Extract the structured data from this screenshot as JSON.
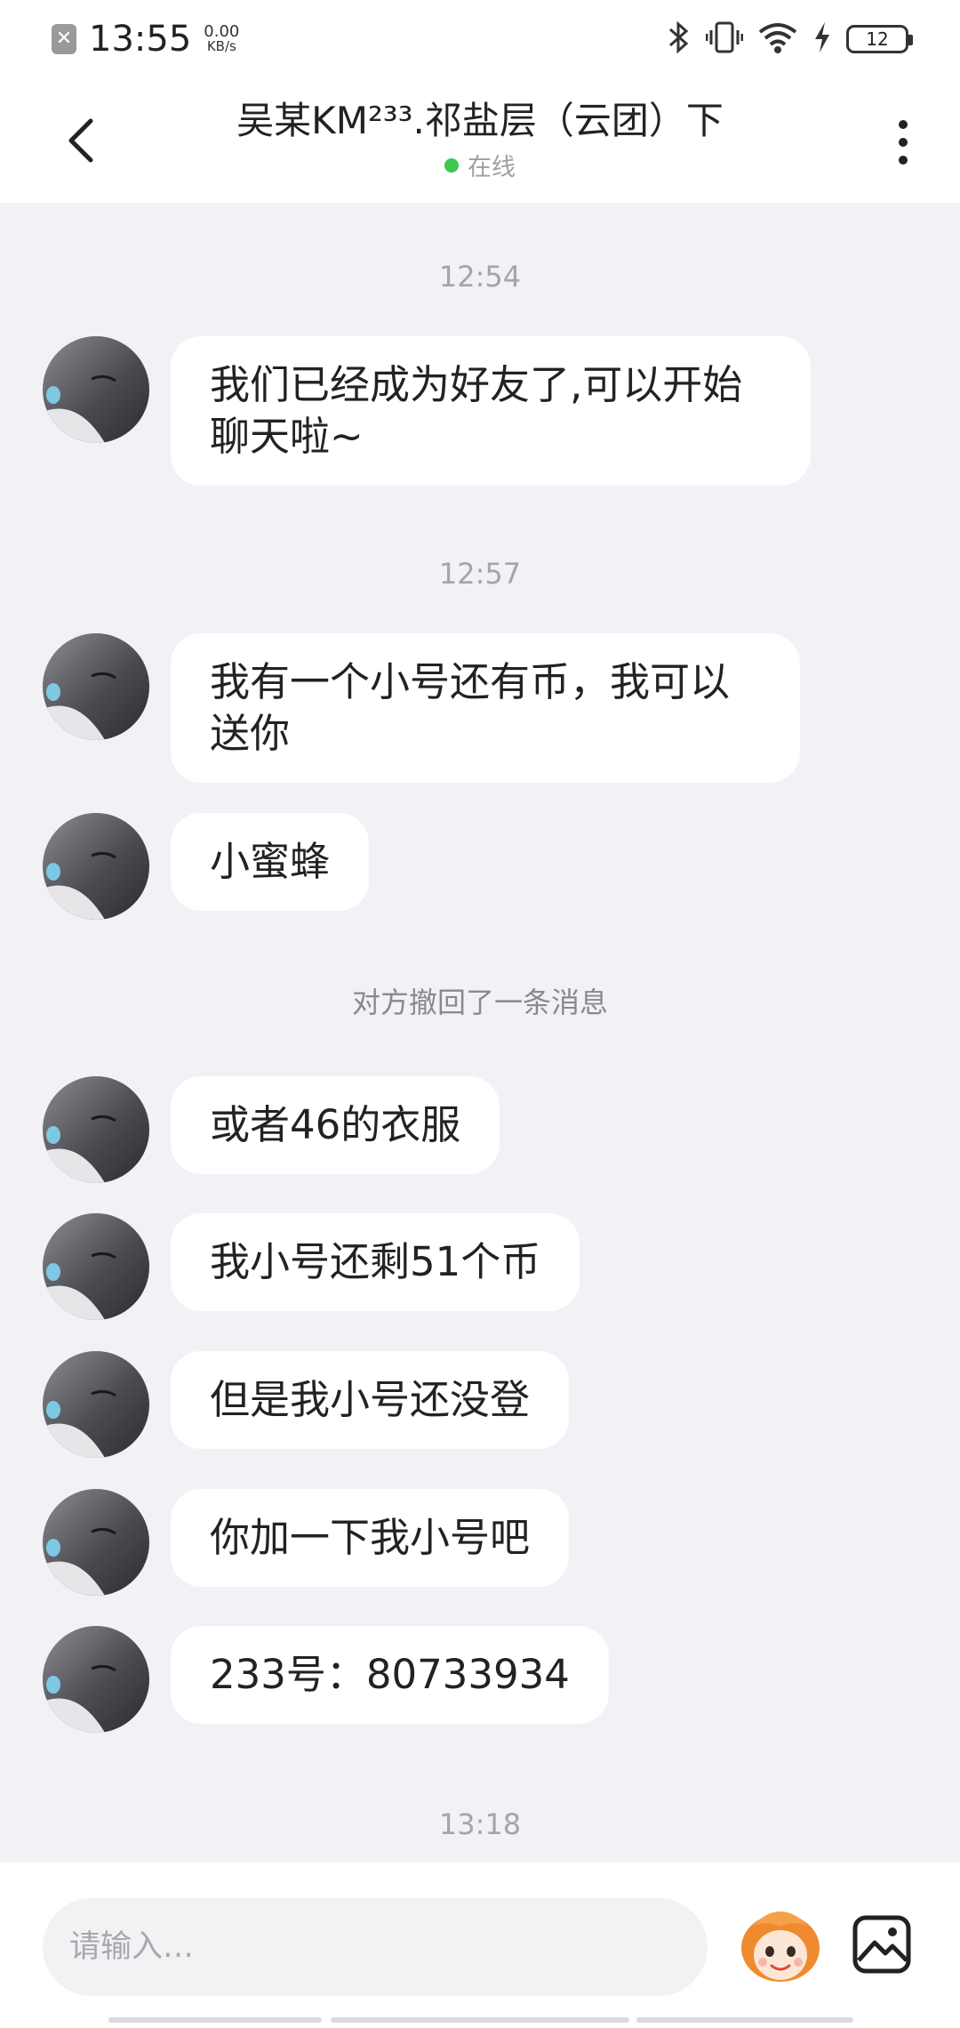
{
  "status_bar": {
    "time": "13:55",
    "net_speed_value": "0.00",
    "net_speed_unit": "KB/s",
    "battery": "12",
    "icons": [
      "notification-icon",
      "bluetooth-icon",
      "vibrate-icon",
      "wifi-icon",
      "charging-icon",
      "battery-icon"
    ]
  },
  "header": {
    "title": "吴某KM²³³.祁盐层（云团）下",
    "status": "在线",
    "status_color": "#3CC851"
  },
  "chat": {
    "timestamps": [
      "12:54",
      "12:57",
      "13:18"
    ],
    "recall_notice": "对方撤回了一条消息",
    "messages": [
      {
        "line1": "我们已经成为好友了,可以开始",
        "line2": "聊天啦~"
      },
      {
        "line1": "我有一个小号还有币，我可以",
        "line2": "送你"
      },
      {
        "text": "小蜜蜂"
      },
      {
        "text": "或者46的衣服"
      },
      {
        "text": "我小号还剩51个币"
      },
      {
        "text": "但是我小号还没登"
      },
      {
        "text": "你加一下我小号吧"
      },
      {
        "text": "233号：80733934"
      }
    ]
  },
  "input": {
    "placeholder": "请输入…"
  },
  "colors": {
    "background": "#F1F1F6",
    "bubble": "#FFFFFF",
    "accent_online": "#3CC851",
    "emoji_orange": "#F08A2E"
  }
}
